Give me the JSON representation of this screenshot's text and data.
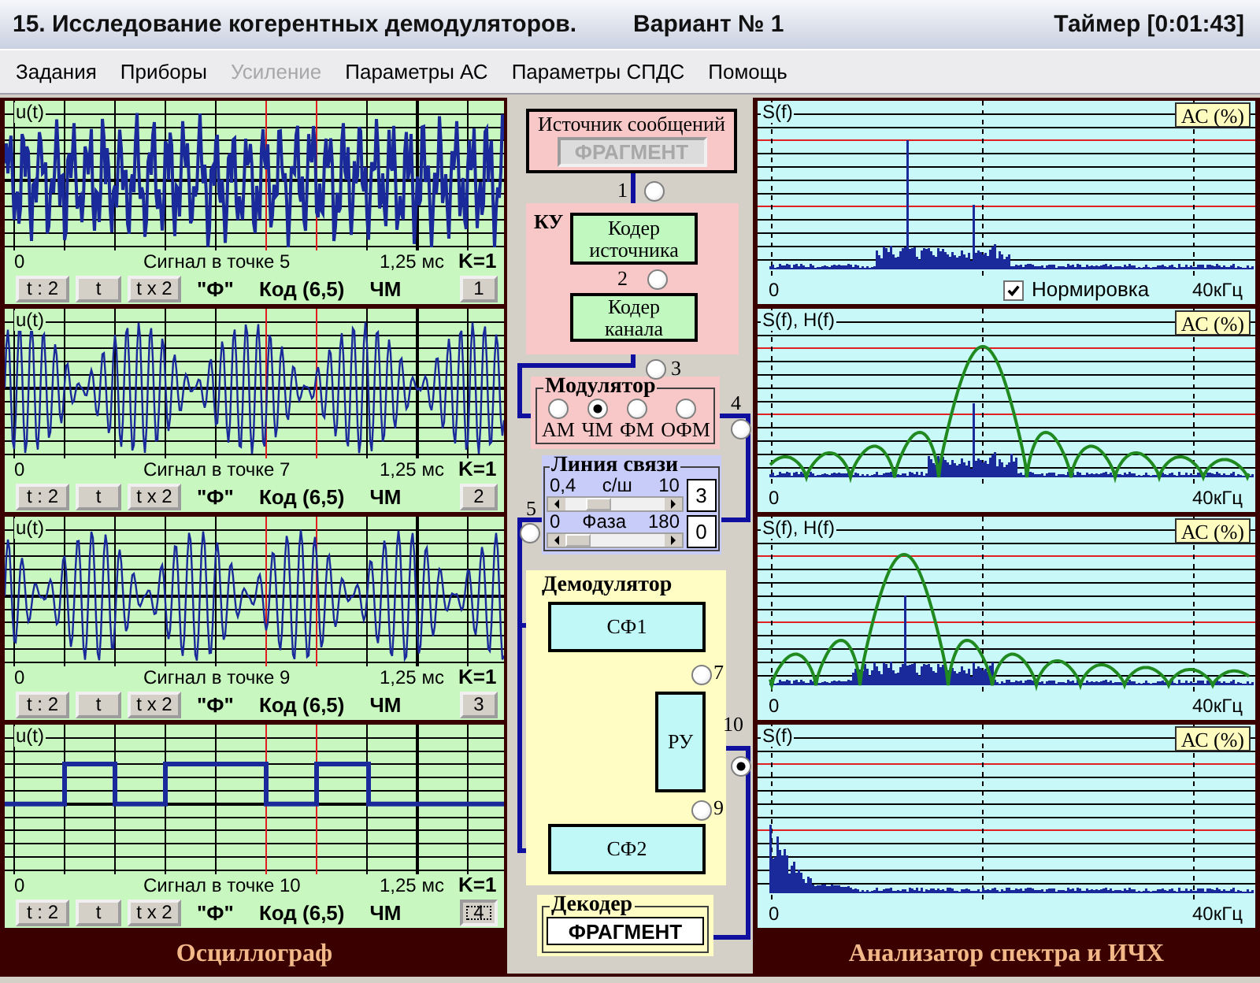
{
  "window": {
    "title": "15. Исследование когерентных демодуляторов.",
    "variant": "Вариант № 1",
    "timer": "Таймер [0:01:43]"
  },
  "menu": [
    {
      "label": "Задания",
      "disabled": false
    },
    {
      "label": "Приборы",
      "disabled": false
    },
    {
      "label": "Усиление",
      "disabled": true
    },
    {
      "label": "Параметры АС",
      "disabled": false
    },
    {
      "label": "Параметры СПДС",
      "disabled": false
    },
    {
      "label": "Помощь",
      "disabled": false
    }
  ],
  "oscilloscope": {
    "title": "Осциллограф",
    "channels": [
      {
        "kind": "noise",
        "axis_label": "u(t)",
        "x_start": "0",
        "caption": "Сигнал в точке 5",
        "x_end": "1,25 мс",
        "gain": "K=1",
        "time_buttons": [
          "t : 2",
          "t",
          "t x 2"
        ],
        "fragment": "\"Ф\"",
        "code": "Код (6,5)",
        "modulation": "ЧМ",
        "channel_button": {
          "label": "1",
          "selected": false
        }
      },
      {
        "kind": "burst",
        "axis_label": "u(t)",
        "x_start": "0",
        "caption": "Сигнал в точке 7",
        "x_end": "1,25 мс",
        "gain": "K=1",
        "time_buttons": [
          "t : 2",
          "t",
          "t x 2"
        ],
        "fragment": "\"Ф\"",
        "code": "Код (6,5)",
        "modulation": "ЧМ",
        "channel_button": {
          "label": "2",
          "selected": false
        }
      },
      {
        "kind": "burst",
        "axis_label": "u(t)",
        "x_start": "0",
        "caption": "Сигнал в точке 9",
        "x_end": "1,25 мс",
        "gain": "K=1",
        "time_buttons": [
          "t : 2",
          "t",
          "t x 2"
        ],
        "fragment": "\"Ф\"",
        "code": "Код (6,5)",
        "modulation": "ЧМ",
        "channel_button": {
          "label": "3",
          "selected": false
        }
      },
      {
        "kind": "square",
        "axis_label": "u(t)",
        "x_start": "0",
        "caption": "Сигнал в точке 10",
        "x_end": "1,25 мс",
        "gain": "K=1",
        "time_buttons": [
          "t : 2",
          "t",
          "t x 2"
        ],
        "fragment": "\"Ф\"",
        "code": "Код (6,5)",
        "modulation": "ЧМ",
        "channel_button": {
          "label": "4",
          "selected": true
        }
      }
    ]
  },
  "scheme": {
    "source": {
      "title": "Источник сообщений",
      "value": "ФРАГМЕНТ",
      "disabled": true
    },
    "coder": {
      "title": "КУ",
      "blocks": [
        "Кодер источника",
        "Кодер канала"
      ]
    },
    "probes": [
      {
        "label": "1",
        "selected": false
      },
      {
        "label": "2",
        "selected": false
      },
      {
        "label": "3",
        "selected": false
      },
      {
        "label": "4",
        "selected": false
      },
      {
        "label": "5",
        "selected": false
      },
      {
        "label": "7",
        "selected": false
      },
      {
        "label": "9",
        "selected": false
      },
      {
        "label": "10",
        "selected": true
      }
    ],
    "modulator": {
      "title": "Модулятор",
      "options": [
        {
          "label": "АМ",
          "selected": false
        },
        {
          "label": "ЧМ",
          "selected": true
        },
        {
          "label": "ФМ",
          "selected": false
        },
        {
          "label": "ОФМ",
          "selected": false
        }
      ]
    },
    "channel": {
      "title": "Линия связи",
      "sliders": [
        {
          "min": "0,4",
          "label": "с/ш",
          "max": "10",
          "level": 0.27,
          "value": "3"
        },
        {
          "min": "0",
          "label": "Фаза",
          "max": "180",
          "level": 0,
          "value": "0"
        }
      ]
    },
    "demodulator": {
      "title": "Демодулятор",
      "filters": [
        "СФ1",
        "СФ2"
      ],
      "decision": "РУ"
    },
    "decoder": {
      "title": "Декодер",
      "value": "ФРАГМЕНТ"
    }
  },
  "analyzer": {
    "title": "Анализатор спектра и ИЧХ",
    "channels": [
      {
        "kind": "band",
        "axis_label": "S(f)",
        "scale_button": "АС (%)",
        "x_start": "0",
        "x_end": "40кГц",
        "normalize": {
          "label": "Нормировка",
          "checked": true
        }
      },
      {
        "kind": "band-filter-center",
        "axis_label": "S(f), H(f)",
        "scale_button": "АС (%)",
        "x_start": "0",
        "x_end": "40кГц"
      },
      {
        "kind": "band-filter-left",
        "axis_label": "S(f), H(f)",
        "scale_button": "АС (%)",
        "x_start": "0",
        "x_end": "40кГц"
      },
      {
        "kind": "baseband",
        "axis_label": "S(f)",
        "scale_button": "АС (%)",
        "x_start": "0",
        "x_end": "40кГц"
      }
    ]
  }
}
